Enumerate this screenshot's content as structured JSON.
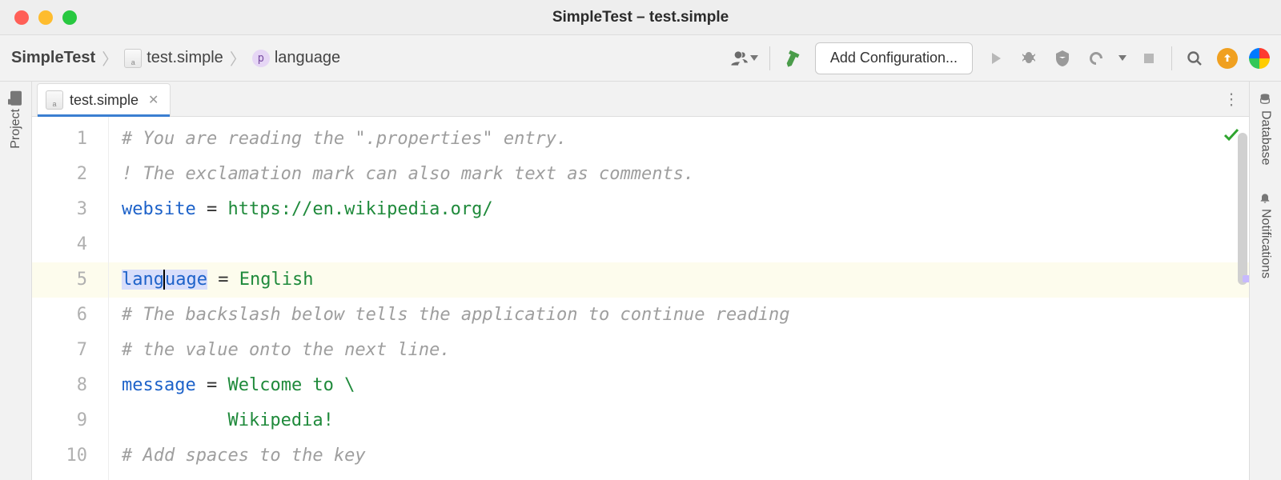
{
  "window": {
    "title": "SimpleTest – test.simple"
  },
  "breadcrumb": {
    "project": "SimpleTest",
    "file": "test.simple",
    "symbol": "language"
  },
  "toolbar": {
    "config_button": "Add Configuration..."
  },
  "left_panel": {
    "project_label": "Project"
  },
  "right_panel": {
    "database_label": "Database",
    "notifications_label": "Notifications"
  },
  "tab": {
    "file_name": "test.simple"
  },
  "editor": {
    "line_numbers": [
      "1",
      "2",
      "3",
      "4",
      "5",
      "6",
      "7",
      "8",
      "9",
      "10"
    ],
    "current_line_index": 4,
    "lines": {
      "l1_comment": "# You are reading the \".properties\" entry.",
      "l2_comment": "! The exclamation mark can also mark text as comments.",
      "l3_key": "website",
      "l3_eq": " = ",
      "l3_val": "https://en.wikipedia.org/",
      "l5_key_sel": "lang",
      "l5_key_rest": "uage",
      "l5_eq": " = ",
      "l5_val": "English",
      "l6_comment": "# The backslash below tells the application to continue reading",
      "l7_comment": "# the value onto the next line.",
      "l8_key": "message",
      "l8_eq": " = ",
      "l8_val": "Welcome to \\",
      "l9_indent": "          ",
      "l9_val": "Wikipedia!",
      "l10_comment": "# Add spaces to the key"
    }
  }
}
